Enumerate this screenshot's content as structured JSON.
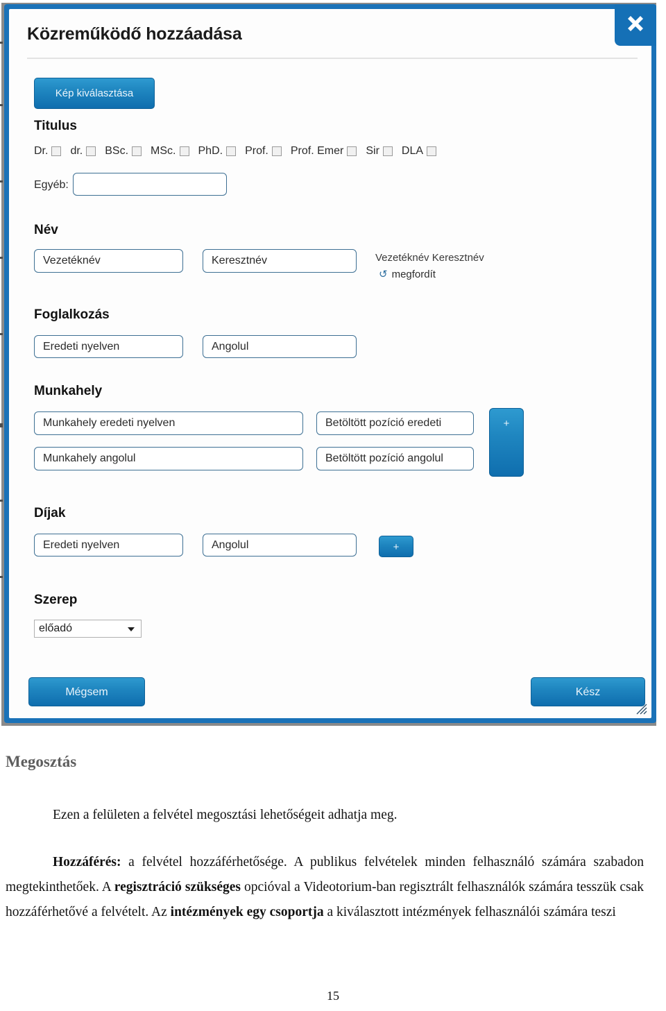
{
  "dialog": {
    "title": "Közreműködő hozzáadása",
    "close_icon": "close-icon",
    "pick_image_button": "Kép kiválasztása",
    "sections": {
      "titulus": {
        "heading": "Titulus",
        "checkboxes": [
          "Dr.",
          "dr.",
          "BSc.",
          "MSc.",
          "PhD.",
          "Prof.",
          "Prof. Emer",
          "Sir",
          "DLA"
        ],
        "other_label": "Egyéb:",
        "other_value": ""
      },
      "nev": {
        "heading": "Név",
        "lastname_placeholder": "Vezetéknév",
        "firstname_placeholder": "Keresztnév",
        "preview": "Vezetéknév Keresztnév",
        "reverse_label": "megfordít",
        "reverse_icon": "reverse-arrows-icon"
      },
      "foglalkozas": {
        "heading": "Foglalkozás",
        "original_placeholder": "Eredeti nyelven",
        "english_placeholder": "Angolul"
      },
      "munkahely": {
        "heading": "Munkahely",
        "workplace_original_placeholder": "Munkahely eredeti nyelven",
        "workplace_english_placeholder": "Munkahely angolul",
        "position_original_placeholder": "Betöltött pozíció eredeti",
        "position_english_placeholder": "Betöltött pozíció angolul",
        "add_button": "+"
      },
      "dijak": {
        "heading": "Díjak",
        "original_placeholder": "Eredeti nyelven",
        "english_placeholder": "Angolul",
        "add_button": "+"
      },
      "szerep": {
        "heading": "Szerep",
        "selected_option": "előadó"
      }
    },
    "footer": {
      "cancel_label": "Mégsem",
      "done_label": "Kész"
    },
    "resize_grip_icon": "resize-grip-icon"
  },
  "document": {
    "heading": "Megosztás",
    "paragraph1": "Ezen a felületen a felvétel megosztási lehetőségeit adhatja meg.",
    "paragraph2_parts": {
      "b1": "Hozzáférés:",
      "t1": " a felvétel hozzáférhetősége. A publikus felvételek minden felhasználó számára szabadon megtekinthetőek. A ",
      "b2": "regisztráció szükséges",
      "t2": " opcióval a Videotorium-ban regisztrált felhasználók számára tesszük csak hozzáférhetővé a felvételt. Az ",
      "b3": "intézmények egy csoportja",
      "t3": " a kiválasztott intézmények felhasználói számára teszi"
    },
    "page_number": "15"
  },
  "colors": {
    "accent_blue": "#1a72b8",
    "button_blue": "#1f86c0",
    "input_border": "#3d6f93",
    "heading_gray": "#5e5e5e"
  }
}
